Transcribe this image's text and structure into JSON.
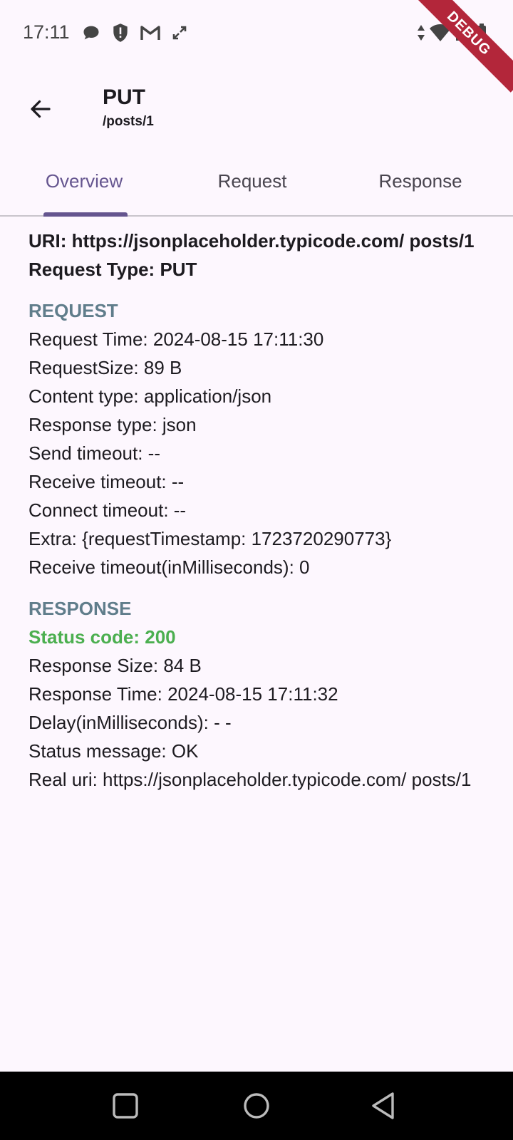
{
  "status_bar": {
    "time": "17:11",
    "left_icons": [
      "chat-icon",
      "shield-alert-icon",
      "gmail-icon",
      "sync-icon"
    ],
    "right_icons": [
      "data-arrows-icon",
      "wifi-icon",
      "signal-icon",
      "battery-icon"
    ],
    "debug_label": "DEBUG"
  },
  "app_bar": {
    "method": "PUT",
    "path": "/posts/1"
  },
  "tabs": [
    {
      "label": "Overview",
      "active": true
    },
    {
      "label": "Request",
      "active": false
    },
    {
      "label": "Response",
      "active": false
    }
  ],
  "overview": {
    "uri": "URI: https://jsonplaceholder.typicode.com/ posts/1",
    "request_type": "Request Type: PUT",
    "request_section_title": "REQUEST",
    "request_lines": [
      "Request Time: 2024-08-15 17:11:30",
      "RequestSize: 89 B",
      "Content type: application/json",
      "Response type: json",
      "Send timeout: --",
      "Receive timeout: --",
      "Connect timeout: --",
      "Extra: {requestTimestamp: 1723720290773}",
      "Receive timeout(inMilliseconds): 0"
    ],
    "response_section_title": "RESPONSE",
    "status_code": "Status code: 200",
    "response_lines": [
      "Response Size: 84 B",
      "Response Time: 2024-08-15 17:11:32",
      "Delay(inMilliseconds): - -",
      "Status message: OK",
      "Real uri: https://jsonplaceholder.typicode.com/ posts/1"
    ]
  },
  "colors": {
    "accent": "#65558f",
    "section_title": "#607d8b",
    "status_ok": "#4caf50",
    "background": "#fdf7fe"
  },
  "nav_bar": {
    "icons": [
      "recents-square-icon",
      "home-circle-icon",
      "back-triangle-icon"
    ]
  }
}
